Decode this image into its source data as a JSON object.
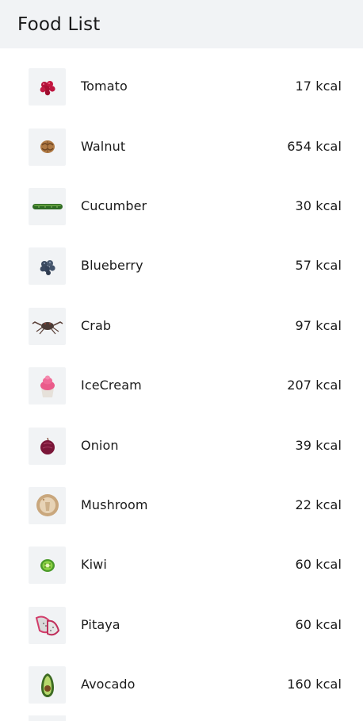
{
  "header": {
    "title": "Food List"
  },
  "foods": [
    {
      "name": "Tomato",
      "kcal": "17 kcal",
      "icon": "tomato-icon"
    },
    {
      "name": "Walnut",
      "kcal": "654 kcal",
      "icon": "walnut-icon"
    },
    {
      "name": "Cucumber",
      "kcal": "30 kcal",
      "icon": "cucumber-icon"
    },
    {
      "name": "Blueberry",
      "kcal": "57 kcal",
      "icon": "blueberry-icon"
    },
    {
      "name": "Crab",
      "kcal": "97 kcal",
      "icon": "crab-icon"
    },
    {
      "name": "IceCream",
      "kcal": "207 kcal",
      "icon": "icecream-icon"
    },
    {
      "name": "Onion",
      "kcal": "39 kcal",
      "icon": "onion-icon"
    },
    {
      "name": "Mushroom",
      "kcal": "22 kcal",
      "icon": "mushroom-icon"
    },
    {
      "name": "Kiwi",
      "kcal": "60 kcal",
      "icon": "kiwi-icon"
    },
    {
      "name": "Pitaya",
      "kcal": "60 kcal",
      "icon": "pitaya-icon"
    },
    {
      "name": "Avocado",
      "kcal": "160 kcal",
      "icon": "avocado-icon"
    }
  ]
}
